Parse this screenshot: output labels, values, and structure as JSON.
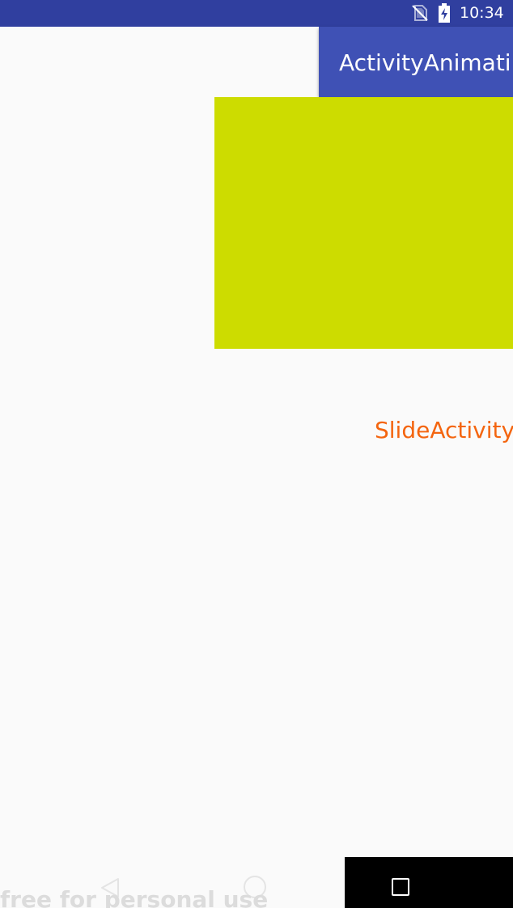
{
  "status_bar": {
    "time": "10:34",
    "icons": [
      "no-sim-icon",
      "battery-charging-icon"
    ],
    "background": "#303f9f"
  },
  "app_bar": {
    "title": "ActivityAnimati",
    "background": "#3f51b5"
  },
  "content": {
    "box_color": "#cddc00",
    "label": "SlideActivity",
    "label_color": "#f4650f"
  },
  "nav_bar": {
    "buttons": [
      "back-icon",
      "home-icon",
      "recents-icon"
    ]
  },
  "watermark": {
    "text": "free for personal use"
  }
}
